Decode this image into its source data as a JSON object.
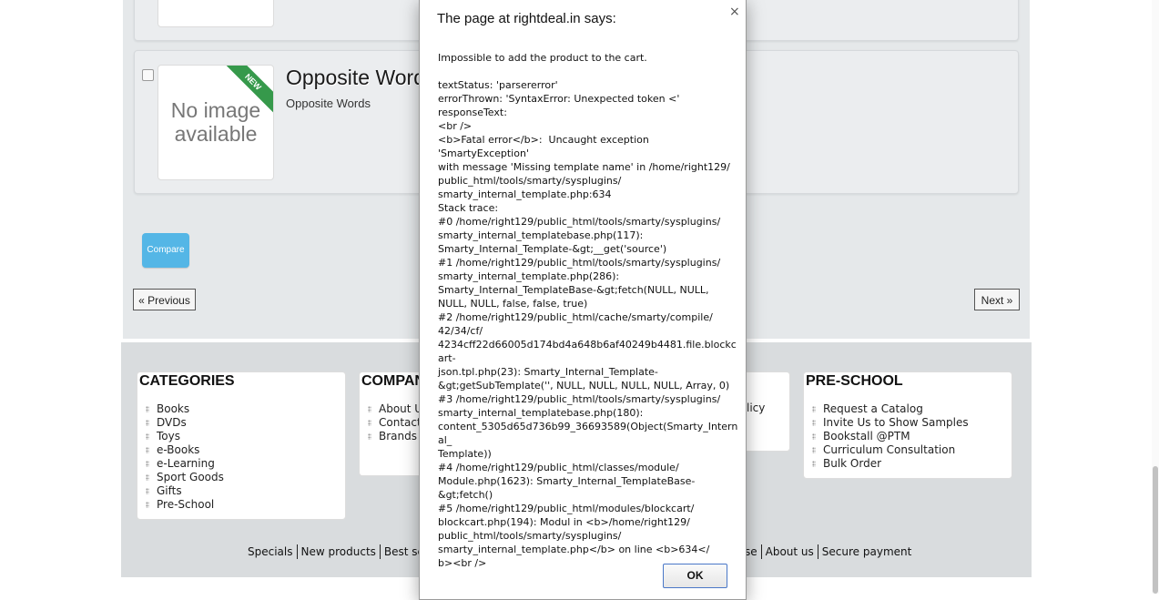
{
  "product": {
    "no_image_text": "No image available",
    "new_badge": "NEW",
    "title": "Opposite Words",
    "subtitle": "Opposite Words"
  },
  "list": {
    "compare_label": "Compare",
    "prev_label": "« Previous",
    "next_label": "Next »"
  },
  "footer": {
    "categories": {
      "title": "CATEGORIES",
      "items": [
        "Books",
        "DVDs",
        "Toys",
        "e-Books",
        "e-Learning",
        "Sport Goods",
        "Gifts",
        "Pre-School"
      ]
    },
    "company": {
      "title": "COMPAN",
      "items": [
        "About U",
        "Contact",
        "Brands"
      ]
    },
    "middle_fragment": "licy",
    "preschool": {
      "title": "PRE-SCHOOL",
      "items": [
        "Request a Catalog",
        "Invite Us to Show Samples",
        "Bookstall @PTM",
        "Curriculum Consultation",
        "Bulk Order"
      ]
    },
    "links_left": [
      "Specials",
      "New products",
      "Best selle"
    ],
    "links_right": [
      "se",
      "About us",
      "Secure payment"
    ]
  },
  "dialog": {
    "title": "The page at rightdeal.in says:",
    "close_glyph": "×",
    "message": "Impossible to add the product to the cart.\n\ntextStatus: 'parsererror'\nerrorThrown: 'SyntaxError: Unexpected token <'\nresponseText:\n<br />\n<b>Fatal error</b>:  Uncaught exception 'SmartyException'\nwith message 'Missing template name' in /home/right129/\npublic_html/tools/smarty/sysplugins/\nsmarty_internal_template.php:634\nStack trace:\n#0 /home/right129/public_html/tools/smarty/sysplugins/\nsmarty_internal_templatebase.php(117):\nSmarty_Internal_Template-&gt;__get('source')\n#1 /home/right129/public_html/tools/smarty/sysplugins/\nsmarty_internal_template.php(286):\nSmarty_Internal_TemplateBase-&gt;fetch(NULL, NULL,\nNULL, NULL, false, false, true)\n#2 /home/right129/public_html/cache/smarty/compile/\n42/34/cf/\n4234cff22d66005d174bd4a648b6af40249b4481.file.blockcart-\njson.tpl.php(23): Smarty_Internal_Template-\n&gt;getSubTemplate('', NULL, NULL, NULL, NULL, Array, 0)\n#3 /home/right129/public_html/tools/smarty/sysplugins/\nsmarty_internal_templatebase.php(180):\ncontent_5305d65d736b99_36693589(Object(Smarty_Internal_\nTemplate))\n#4 /home/right129/public_html/classes/module/\nModule.php(1623): Smarty_Internal_TemplateBase-\n&gt;fetch()\n#5 /home/right129/public_html/modules/blockcart/\nblockcart.php(194): Modul in <b>/home/right129/\npublic_html/tools/smarty/sysplugins/\nsmarty_internal_template.php</b> on line <b>634</\nb><br />",
    "ok_label": "OK"
  }
}
